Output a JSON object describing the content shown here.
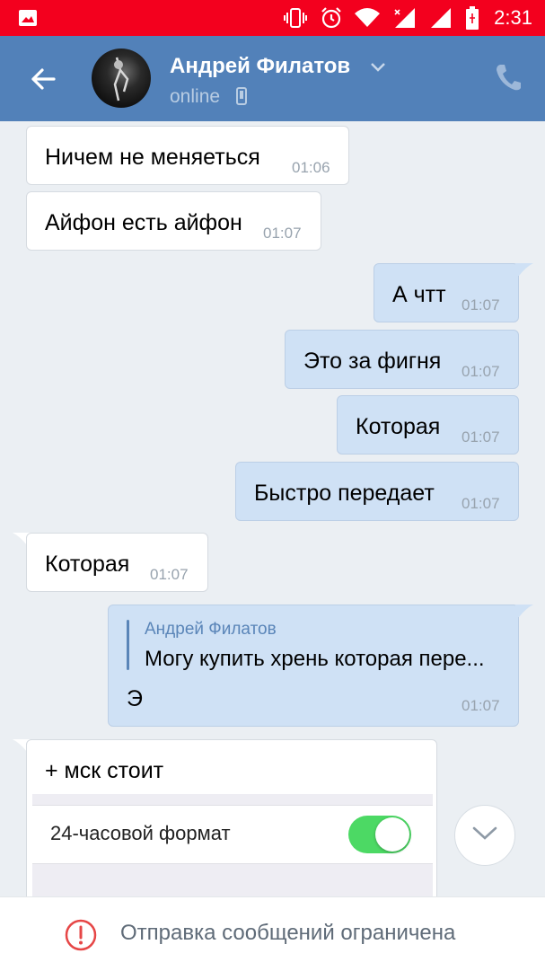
{
  "status_bar": {
    "time": "2:31",
    "icons": [
      "image-icon",
      "vibrate-icon",
      "alarm-icon",
      "wifi-icon",
      "signal-icon",
      "signal-icon",
      "battery-charging-icon"
    ]
  },
  "header": {
    "name": "Андрей Филатов",
    "status": "online",
    "icons": [
      "back-arrow-icon",
      "avatar",
      "chevron-down-icon",
      "mobile-icon",
      "phone-icon"
    ]
  },
  "messages": [
    {
      "dir": "in",
      "text": "Ничем не меняеться",
      "time": "01:06"
    },
    {
      "dir": "in",
      "text": "Айфон есть айфон",
      "time": "01:07"
    },
    {
      "dir": "out",
      "text": "А чтт",
      "time": "01:07"
    },
    {
      "dir": "out",
      "text": "Это за фигня",
      "time": "01:07"
    },
    {
      "dir": "out",
      "text": "Которая",
      "time": "01:07"
    },
    {
      "dir": "out",
      "text": "Быстро передает",
      "time": "01:07"
    },
    {
      "dir": "in",
      "text": "Которая",
      "time": "01:07"
    },
    {
      "dir": "out",
      "reply_author": "Андрей Филатов",
      "reply_text": "Могу купить хрень которая пере...",
      "text": "Э",
      "time": "01:07"
    },
    {
      "dir": "in",
      "text": "+ мск стоит",
      "embed_label": "24-часовой формат",
      "embed_toggle_on": true
    }
  ],
  "bottom_bar": {
    "notice": "Отправка сообщений ограничена",
    "icon": "warning-circle-icon"
  },
  "colors": {
    "status_bar": "#f3001e",
    "header": "#5281b9",
    "background": "#ebeff3",
    "incoming_bubble": "#ffffff",
    "outgoing_bubble": "#cfe1f5",
    "toggle_on": "#4cd964",
    "warning": "#e64646"
  }
}
